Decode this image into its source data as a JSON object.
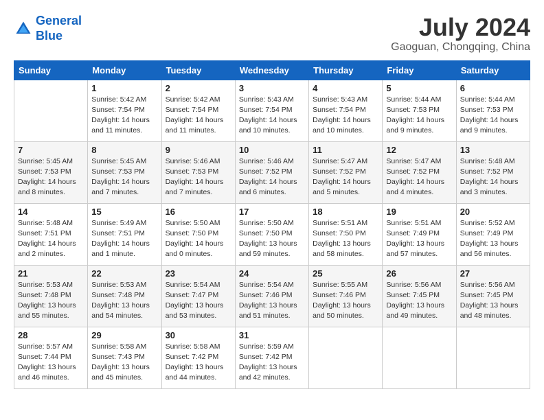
{
  "header": {
    "logo_line1": "General",
    "logo_line2": "Blue",
    "month_year": "July 2024",
    "location": "Gaoguan, Chongqing, China"
  },
  "days_of_week": [
    "Sunday",
    "Monday",
    "Tuesday",
    "Wednesday",
    "Thursday",
    "Friday",
    "Saturday"
  ],
  "weeks": [
    [
      {
        "day": "",
        "info": ""
      },
      {
        "day": "1",
        "info": "Sunrise: 5:42 AM\nSunset: 7:54 PM\nDaylight: 14 hours\nand 11 minutes."
      },
      {
        "day": "2",
        "info": "Sunrise: 5:42 AM\nSunset: 7:54 PM\nDaylight: 14 hours\nand 11 minutes."
      },
      {
        "day": "3",
        "info": "Sunrise: 5:43 AM\nSunset: 7:54 PM\nDaylight: 14 hours\nand 10 minutes."
      },
      {
        "day": "4",
        "info": "Sunrise: 5:43 AM\nSunset: 7:54 PM\nDaylight: 14 hours\nand 10 minutes."
      },
      {
        "day": "5",
        "info": "Sunrise: 5:44 AM\nSunset: 7:53 PM\nDaylight: 14 hours\nand 9 minutes."
      },
      {
        "day": "6",
        "info": "Sunrise: 5:44 AM\nSunset: 7:53 PM\nDaylight: 14 hours\nand 9 minutes."
      }
    ],
    [
      {
        "day": "7",
        "info": "Sunrise: 5:45 AM\nSunset: 7:53 PM\nDaylight: 14 hours\nand 8 minutes."
      },
      {
        "day": "8",
        "info": "Sunrise: 5:45 AM\nSunset: 7:53 PM\nDaylight: 14 hours\nand 7 minutes."
      },
      {
        "day": "9",
        "info": "Sunrise: 5:46 AM\nSunset: 7:53 PM\nDaylight: 14 hours\nand 7 minutes."
      },
      {
        "day": "10",
        "info": "Sunrise: 5:46 AM\nSunset: 7:52 PM\nDaylight: 14 hours\nand 6 minutes."
      },
      {
        "day": "11",
        "info": "Sunrise: 5:47 AM\nSunset: 7:52 PM\nDaylight: 14 hours\nand 5 minutes."
      },
      {
        "day": "12",
        "info": "Sunrise: 5:47 AM\nSunset: 7:52 PM\nDaylight: 14 hours\nand 4 minutes."
      },
      {
        "day": "13",
        "info": "Sunrise: 5:48 AM\nSunset: 7:52 PM\nDaylight: 14 hours\nand 3 minutes."
      }
    ],
    [
      {
        "day": "14",
        "info": "Sunrise: 5:48 AM\nSunset: 7:51 PM\nDaylight: 14 hours\nand 2 minutes."
      },
      {
        "day": "15",
        "info": "Sunrise: 5:49 AM\nSunset: 7:51 PM\nDaylight: 14 hours\nand 1 minute."
      },
      {
        "day": "16",
        "info": "Sunrise: 5:50 AM\nSunset: 7:50 PM\nDaylight: 14 hours\nand 0 minutes."
      },
      {
        "day": "17",
        "info": "Sunrise: 5:50 AM\nSunset: 7:50 PM\nDaylight: 13 hours\nand 59 minutes."
      },
      {
        "day": "18",
        "info": "Sunrise: 5:51 AM\nSunset: 7:50 PM\nDaylight: 13 hours\nand 58 minutes."
      },
      {
        "day": "19",
        "info": "Sunrise: 5:51 AM\nSunset: 7:49 PM\nDaylight: 13 hours\nand 57 minutes."
      },
      {
        "day": "20",
        "info": "Sunrise: 5:52 AM\nSunset: 7:49 PM\nDaylight: 13 hours\nand 56 minutes."
      }
    ],
    [
      {
        "day": "21",
        "info": "Sunrise: 5:53 AM\nSunset: 7:48 PM\nDaylight: 13 hours\nand 55 minutes."
      },
      {
        "day": "22",
        "info": "Sunrise: 5:53 AM\nSunset: 7:48 PM\nDaylight: 13 hours\nand 54 minutes."
      },
      {
        "day": "23",
        "info": "Sunrise: 5:54 AM\nSunset: 7:47 PM\nDaylight: 13 hours\nand 53 minutes."
      },
      {
        "day": "24",
        "info": "Sunrise: 5:54 AM\nSunset: 7:46 PM\nDaylight: 13 hours\nand 51 minutes."
      },
      {
        "day": "25",
        "info": "Sunrise: 5:55 AM\nSunset: 7:46 PM\nDaylight: 13 hours\nand 50 minutes."
      },
      {
        "day": "26",
        "info": "Sunrise: 5:56 AM\nSunset: 7:45 PM\nDaylight: 13 hours\nand 49 minutes."
      },
      {
        "day": "27",
        "info": "Sunrise: 5:56 AM\nSunset: 7:45 PM\nDaylight: 13 hours\nand 48 minutes."
      }
    ],
    [
      {
        "day": "28",
        "info": "Sunrise: 5:57 AM\nSunset: 7:44 PM\nDaylight: 13 hours\nand 46 minutes."
      },
      {
        "day": "29",
        "info": "Sunrise: 5:58 AM\nSunset: 7:43 PM\nDaylight: 13 hours\nand 45 minutes."
      },
      {
        "day": "30",
        "info": "Sunrise: 5:58 AM\nSunset: 7:42 PM\nDaylight: 13 hours\nand 44 minutes."
      },
      {
        "day": "31",
        "info": "Sunrise: 5:59 AM\nSunset: 7:42 PM\nDaylight: 13 hours\nand 42 minutes."
      },
      {
        "day": "",
        "info": ""
      },
      {
        "day": "",
        "info": ""
      },
      {
        "day": "",
        "info": ""
      }
    ]
  ]
}
